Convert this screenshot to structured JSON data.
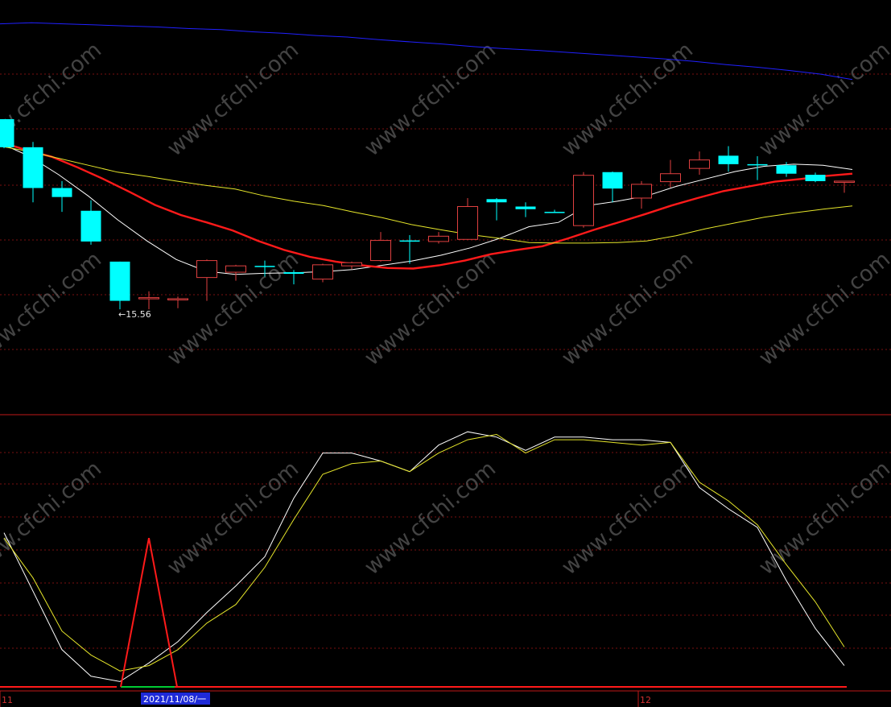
{
  "watermark": "www.cfchi.com",
  "colors": {
    "background": "#000000",
    "grid": "#7a1010",
    "divider": "#c01818",
    "up": "#e04040",
    "down": "#00ffff",
    "ma_short": "#ffffff",
    "ma_mid": "#ff1a1a",
    "ma_long": "#e6e62a",
    "ma_longest": "#2020ff",
    "kdj_fast": "#ffffff",
    "kdj_slow": "#e6e62a",
    "signal": "#ff1a1a",
    "signal_base": "#00cc33",
    "date_box": "#1e2ad8"
  },
  "chart_data": [
    {
      "type": "candlestick",
      "panel": "price",
      "ylim": [
        13.6,
        21.4
      ],
      "low_annotation": "←15.56",
      "candles": [
        {
          "o": 19.15,
          "c": 18.62,
          "h": 19.15,
          "l": 18.6
        },
        {
          "o": 18.62,
          "c": 17.85,
          "h": 18.72,
          "l": 17.58
        },
        {
          "o": 17.85,
          "c": 17.68,
          "h": 17.98,
          "l": 17.4
        },
        {
          "o": 17.42,
          "c": 16.84,
          "h": 17.62,
          "l": 16.78
        },
        {
          "o": 16.46,
          "c": 15.72,
          "h": 16.46,
          "l": 15.56
        },
        {
          "o": 15.78,
          "c": 15.78,
          "h": 15.9,
          "l": 15.56
        },
        {
          "o": 15.76,
          "c": 15.76,
          "h": 15.8,
          "l": 15.58
        },
        {
          "o": 16.16,
          "c": 16.48,
          "h": 16.5,
          "l": 15.72
        },
        {
          "o": 16.26,
          "c": 16.38,
          "h": 16.4,
          "l": 16.1
        },
        {
          "o": 16.38,
          "c": 16.36,
          "h": 16.48,
          "l": 16.18
        },
        {
          "o": 16.26,
          "c": 16.23,
          "h": 16.3,
          "l": 16.03
        },
        {
          "o": 16.13,
          "c": 16.4,
          "h": 16.42,
          "l": 16.07
        },
        {
          "o": 16.38,
          "c": 16.44,
          "h": 16.46,
          "l": 16.32
        },
        {
          "o": 16.48,
          "c": 16.86,
          "h": 17.02,
          "l": 16.46
        },
        {
          "o": 16.86,
          "c": 16.84,
          "h": 16.96,
          "l": 16.42
        },
        {
          "o": 16.84,
          "c": 16.94,
          "h": 17.02,
          "l": 16.8
        },
        {
          "o": 16.88,
          "c": 17.5,
          "h": 17.66,
          "l": 16.88
        },
        {
          "o": 17.64,
          "c": 17.58,
          "h": 17.66,
          "l": 17.24
        },
        {
          "o": 17.5,
          "c": 17.45,
          "h": 17.58,
          "l": 17.3
        },
        {
          "o": 17.4,
          "c": 17.38,
          "h": 17.44,
          "l": 17.38
        },
        {
          "o": 17.14,
          "c": 18.09,
          "h": 18.15,
          "l": 17.1
        },
        {
          "o": 18.15,
          "c": 17.84,
          "h": 18.16,
          "l": 17.58
        },
        {
          "o": 17.66,
          "c": 17.92,
          "h": 17.98,
          "l": 17.46
        },
        {
          "o": 17.97,
          "c": 18.12,
          "h": 18.38,
          "l": 17.86
        },
        {
          "o": 18.22,
          "c": 18.38,
          "h": 18.54,
          "l": 18.1
        },
        {
          "o": 18.46,
          "c": 18.3,
          "h": 18.64,
          "l": 18.16
        },
        {
          "o": 18.3,
          "c": 18.28,
          "h": 18.45,
          "l": 18.0
        },
        {
          "o": 18.28,
          "c": 18.12,
          "h": 18.34,
          "l": 18.06
        },
        {
          "o": 18.1,
          "c": 17.98,
          "h": 18.14,
          "l": 17.96
        },
        {
          "o": 17.96,
          "c": 17.98,
          "h": 17.98,
          "l": 17.76
        }
      ],
      "series": [
        {
          "key": "ma_short",
          "values": [
            18.7,
            18.45,
            18.1,
            17.7,
            17.25,
            16.85,
            16.5,
            16.28,
            16.22,
            16.24,
            16.25,
            16.27,
            16.31,
            16.39,
            16.47,
            16.58,
            16.72,
            16.9,
            17.12,
            17.2,
            17.52,
            17.6,
            17.7,
            17.88,
            18.02,
            18.16,
            18.26,
            18.3,
            18.28,
            18.2
          ]
        },
        {
          "key": "ma_mid",
          "values": [
            18.72,
            18.57,
            18.44,
            18.24,
            18.02,
            17.78,
            17.53,
            17.34,
            17.2,
            17.05,
            16.85,
            16.68,
            16.55,
            16.46,
            16.39,
            16.34,
            16.33,
            16.39,
            16.48,
            16.6,
            16.68,
            16.75,
            16.9,
            17.06,
            17.21,
            17.36,
            17.52,
            17.66,
            17.79,
            17.88,
            17.97,
            18.02,
            18.08,
            18.12
          ]
        },
        {
          "key": "ma_long",
          "values": [
            18.64,
            18.54,
            18.41,
            18.28,
            18.15,
            18.07,
            17.98,
            17.9,
            17.83,
            17.7,
            17.6,
            17.52,
            17.4,
            17.29,
            17.16,
            17.06,
            16.97,
            16.9,
            16.82,
            16.81,
            16.81,
            16.82,
            16.85,
            16.95,
            17.08,
            17.19,
            17.3,
            17.38,
            17.45,
            17.51
          ]
        },
        {
          "key": "ma_longest",
          "values": [
            20.95,
            20.97,
            20.95,
            20.93,
            20.91,
            20.89,
            20.86,
            20.84,
            20.8,
            20.77,
            20.73,
            20.7,
            20.65,
            20.61,
            20.57,
            20.52,
            20.48,
            20.45,
            20.41,
            20.37,
            20.33,
            20.29,
            20.24,
            20.18,
            20.13,
            20.07,
            20.0,
            19.9
          ]
        }
      ]
    },
    {
      "type": "line",
      "panel": "indicator",
      "ylim": [
        0,
        100
      ],
      "series": [
        {
          "key": "kdj_fast",
          "values": [
            58,
            36,
            14,
            4,
            2,
            9,
            17,
            28,
            38,
            49,
            71,
            88,
            88,
            85,
            81,
            91,
            96,
            94,
            89,
            94,
            94,
            93,
            93,
            92,
            75,
            67,
            60,
            40,
            22,
            8
          ]
        },
        {
          "key": "kdj_slow",
          "values": [
            56,
            41,
            21,
            12,
            6,
            8,
            14,
            24,
            31,
            45,
            63,
            80,
            84,
            85,
            81,
            88,
            93,
            95,
            88,
            93,
            93,
            92,
            91,
            92,
            77,
            70,
            61,
            46,
            32,
            15
          ]
        }
      ],
      "signal": {
        "values": [
          0,
          0,
          0,
          0,
          0,
          56,
          0,
          0,
          0,
          0,
          0,
          0,
          0,
          0,
          0,
          0,
          0,
          0,
          0,
          0,
          0,
          0,
          0,
          0,
          0,
          0,
          0,
          0,
          0,
          0
        ]
      }
    }
  ],
  "x_axis": {
    "labels": [
      {
        "index": 0,
        "text": "11"
      },
      {
        "index": 22,
        "text": "12"
      }
    ],
    "selected_date": "2021/11/08/一"
  }
}
